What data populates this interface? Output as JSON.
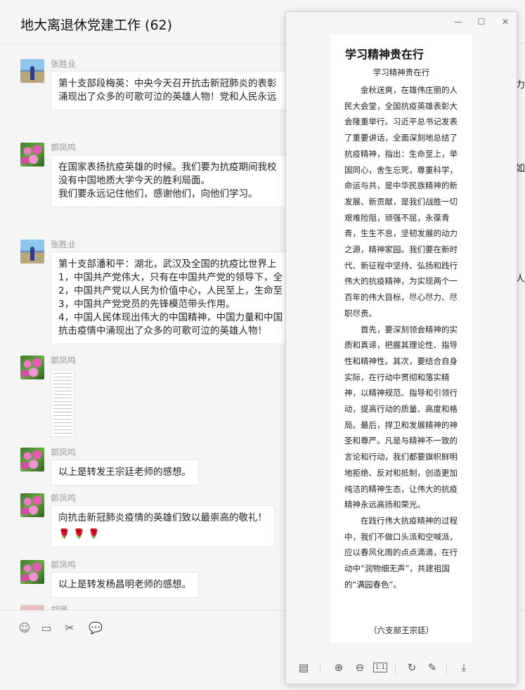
{
  "chat": {
    "title": "地大离退休党建工作 (62)",
    "messages": [
      {
        "sender": "张胜业",
        "lines": [
          "第十支部段梅英：中央今天召开抗击新冠肺炎的表彰",
          "涌现出了众多的可歌可泣的英雄人物！党和人民永远"
        ],
        "edge": "为力"
      },
      {
        "sender": "郭凤鸣",
        "lines": [
          "在国家表扬抗疫英雄的时候。我们要为抗疫期间我校",
          "没有中国地质大学今天的胜利局面。",
          "我们要永远记住他们，感谢他们，向他们学习。"
        ],
        "edge": "如"
      },
      {
        "sender": "张胜业",
        "lines": [
          "第十支部潘和平：湖北，武汉及全国的抗疫比世界上",
          "1，中国共产党伟大，只有在中国共产党的领导下，全",
          "2，中国共产党以人民为价值中心，人民至上，生命至",
          "3，中国共产党党员的先锋模范带头作用。",
          "4，中国人民体现出伟大的中国精神，中国力量和中国",
          "    抗击疫情中涌现出了众多的可歌可泣的英雄人物！"
        ],
        "edge": "人"
      },
      {
        "sender": "郭凤鸣"
      },
      {
        "sender": "郭凤鸣",
        "lines": [
          "以上是转发王宗廷老师的感想。"
        ]
      },
      {
        "sender": "郭凤鸣",
        "lines": [
          "向抗击新冠肺炎疫情的英雄们致以最崇高的敬礼！",
          "🌹  🌹  🌹"
        ]
      },
      {
        "sender": "郭凤鸣",
        "lines": [
          "以上是转发杨昌明老师的感想。"
        ]
      },
      {
        "sender": "胡珊"
      }
    ]
  },
  "composer": {
    "icons": [
      "emoji-icon",
      "folder-icon",
      "scissors-icon",
      "chat-bubble-icon"
    ]
  },
  "viewer": {
    "doc_title": "学习精神贵在行",
    "doc_subtitle": "学习精神贵在行",
    "paragraphs": [
      "金秋送爽，在雄伟庄丽的人民大会堂，全国抗疫英雄表彰大会隆重举行。习近平总书记发表了重要讲话，全面深刻地总结了抗疫精神，指出：生命至上，举国同心，舍生忘死，尊重科学，命运与共，是中华民族精神的新发展、新贡献，是我们战胜一切艰难险阻，顽强不屈，永葆青青，生生不息，坚韧发展的动力之源，精神家园。我们要在新时代、新征程中坚持、弘扬和践行伟大的抗疫精神，为实现两个一百年的伟大目标，尽心尽力、尽职尽责。",
      "首先，要深刻领会精神的实质和真谛，把握其理论性、指导性和精神性。其次，要结合自身实际，在行动中贯彻和落实精神，以精神规范、指导和引领行动，提高行动的质量、高度和格局。最后，捍卫和发展精神的神圣和尊严。凡是与精神不一致的言论和行动，我们都要旗帜鲜明地拒绝、反对和抵制，创造更加纯洁的精神生态，让伟大的抗疫精神永远高扬和荣光。",
      "在践行伟大抗疫精神的过程中，我们不做口头派和空喊派，应以春风化雨的点点滴滴，在行动中“润物细无声”，共建祖国的“满园春色”。"
    ],
    "signature": "（六支部王宗廷）",
    "toolbar_icons": [
      "thumbnail-toggle-icon",
      "zoom-in-icon",
      "zoom-out-icon",
      "actual-size-icon",
      "rotate-icon",
      "edit-icon",
      "download-icon"
    ],
    "actual_size_label": "1:1"
  }
}
